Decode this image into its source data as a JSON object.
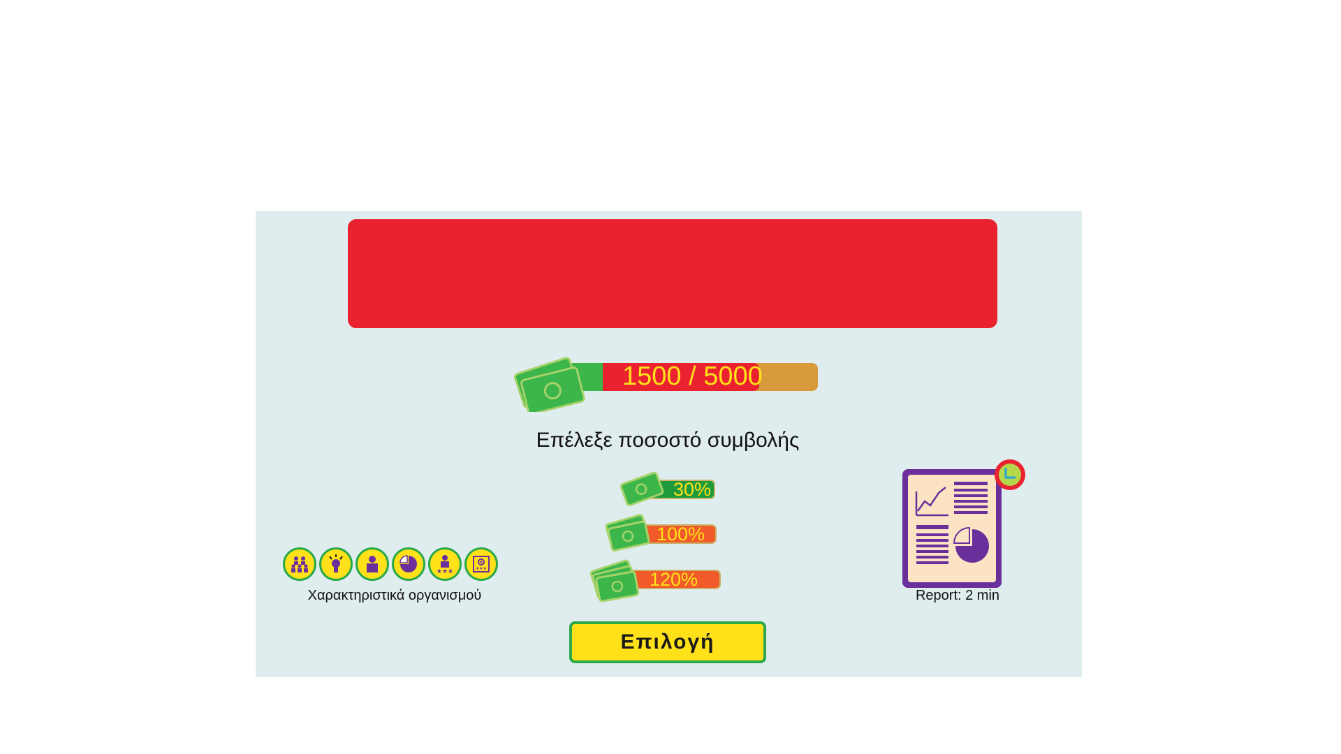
{
  "banner": {
    "color": "#ea212e"
  },
  "budget": {
    "text": "1500 / 5000",
    "current": 1500,
    "total": 5000,
    "colors": {
      "green": "#3cb54a",
      "red": "#ea212e",
      "track": "#d99a3c",
      "text": "#ffe11a"
    }
  },
  "prompt": "Επέλεξε ποσοστό συμβολής",
  "options": [
    {
      "label": "30%",
      "color": "#1e9a3c",
      "text_color": "#ffe11a"
    },
    {
      "label": "100%",
      "color": "#f15a29",
      "text_color": "#ffe11a"
    },
    {
      "label": "120%",
      "color": "#f15a29",
      "text_color": "#ffe11a"
    }
  ],
  "choose_button": {
    "label": "Επιλογή",
    "color": "#ffe11a",
    "border": "#2aa84a"
  },
  "organisation": {
    "label": "Χαρακτηριστικά οργανισμού",
    "icons": [
      "team-icon",
      "idea-bulb-icon",
      "person-icon",
      "pie-chart-icon",
      "star-rated-person-icon",
      "certificate-icon"
    ],
    "icon_bg": "#ffe11a",
    "icon_fg": "#6b2f9c"
  },
  "report": {
    "label": "Report: 2 min",
    "frame": "#6b2f9c",
    "paper": "#fbe3c3",
    "clock_rim": "#ea212e",
    "clock_face": "#b5d84a"
  }
}
